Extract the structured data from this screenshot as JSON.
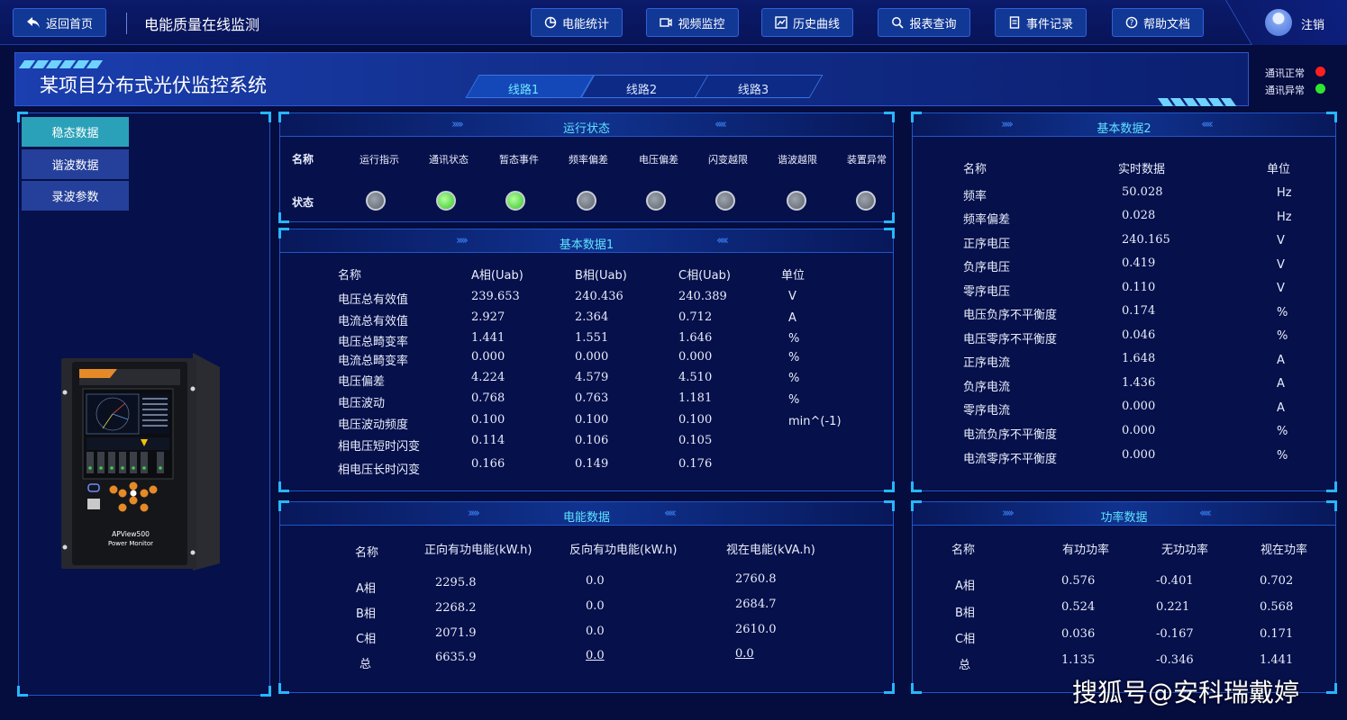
{
  "topbar": {
    "back_label": "返回首页",
    "title": "电能质量在线监测",
    "nav": [
      {
        "label": "电能统计",
        "icon": "pie-chart-icon"
      },
      {
        "label": "视频监控",
        "icon": "video-camera-icon"
      },
      {
        "label": "历史曲线",
        "icon": "line-chart-icon"
      },
      {
        "label": "报表查询",
        "icon": "search-icon"
      },
      {
        "label": "事件记录",
        "icon": "document-icon"
      },
      {
        "label": "帮助文档",
        "icon": "help-icon"
      }
    ],
    "logout_label": "注销"
  },
  "header": {
    "project_title": "某项目分布式光伏监控系统",
    "line_tabs": [
      "线路1",
      "线路2",
      "线路3"
    ],
    "active_tab": "线路1",
    "legend": [
      {
        "label": "通讯正常",
        "color": "#ff1f1f"
      },
      {
        "label": "通讯异常",
        "color": "#2ee62e"
      }
    ]
  },
  "sidebar": {
    "items": [
      "稳态数据",
      "谐波数据",
      "录波参数"
    ],
    "active": "稳态数据",
    "device": {
      "model": "APView500",
      "subtitle": "Power Monitor"
    }
  },
  "run_status": {
    "title": "运行状态",
    "row_name_label": "名称",
    "row_status_label": "状态",
    "items": [
      {
        "label": "运行指示",
        "state": "gray"
      },
      {
        "label": "通讯状态",
        "state": "green"
      },
      {
        "label": "暂态事件",
        "state": "green"
      },
      {
        "label": "频率偏差",
        "state": "gray"
      },
      {
        "label": "电压偏差",
        "state": "gray"
      },
      {
        "label": "闪变越限",
        "state": "gray"
      },
      {
        "label": "谐波越限",
        "state": "gray"
      },
      {
        "label": "装置异常",
        "state": "gray"
      }
    ]
  },
  "basic1": {
    "title": "基本数据1",
    "headers": [
      "名称",
      "A相(Uab)",
      "B相(Uab)",
      "C相(Uab)",
      "单位"
    ],
    "rows": [
      [
        "电压总有效值",
        "239.653",
        "240.436",
        "240.389",
        "V"
      ],
      [
        "电流总有效值",
        "2.927",
        "2.364",
        "0.712",
        "A"
      ],
      [
        "电压总畸变率",
        "1.441",
        "1.551",
        "1.646",
        "%"
      ],
      [
        "电流总畸变率",
        "0.000",
        "0.000",
        "0.000",
        "%"
      ],
      [
        "电压偏差",
        "4.224",
        "4.579",
        "4.510",
        "%"
      ],
      [
        "电压波动",
        "0.768",
        "0.763",
        "1.181",
        "%"
      ],
      [
        "电压波动频度",
        "0.100",
        "0.100",
        "0.100",
        "min^(-1)"
      ],
      [
        "相电压短时闪变",
        "0.114",
        "0.106",
        "0.105",
        ""
      ],
      [
        "相电压长时闪变",
        "0.166",
        "0.149",
        "0.176",
        ""
      ]
    ]
  },
  "basic2": {
    "title": "基本数据2",
    "headers": [
      "名称",
      "实时数据",
      "单位"
    ],
    "rows": [
      [
        "频率",
        "50.028",
        "Hz"
      ],
      [
        "频率偏差",
        "0.028",
        "Hz"
      ],
      [
        "正序电压",
        "240.165",
        "V"
      ],
      [
        "负序电压",
        "0.419",
        "V"
      ],
      [
        "零序电压",
        "0.110",
        "V"
      ],
      [
        "电压负序不平衡度",
        "0.174",
        "%"
      ],
      [
        "电压零序不平衡度",
        "0.046",
        "%"
      ],
      [
        "正序电流",
        "1.648",
        "A"
      ],
      [
        "负序电流",
        "1.436",
        "A"
      ],
      [
        "零序电流",
        "0.000",
        "A"
      ],
      [
        "电流负序不平衡度",
        "0.000",
        "%"
      ],
      [
        "电流零序不平衡度",
        "0.000",
        "%"
      ]
    ]
  },
  "energy": {
    "title": "电能数据",
    "headers": [
      "名称",
      "正向有功电能(kW.h)",
      "反向有功电能(kW.h)",
      "视在电能(kVA.h)"
    ],
    "rows": [
      [
        "A相",
        "2295.8",
        "0.0",
        "2760.8"
      ],
      [
        "B相",
        "2268.2",
        "0.0",
        "2684.7"
      ],
      [
        "C相",
        "2071.9",
        "0.0",
        "2610.0"
      ],
      [
        "总",
        "6635.9",
        "0.0",
        "0.0"
      ]
    ]
  },
  "power": {
    "title": "功率数据",
    "headers": [
      "名称",
      "有功功率",
      "无功功率",
      "视在功率"
    ],
    "rows": [
      [
        "A相",
        "0.576",
        "-0.401",
        "0.702"
      ],
      [
        "B相",
        "0.524",
        "0.221",
        "0.568"
      ],
      [
        "C相",
        "0.036",
        "-0.167",
        "0.171"
      ],
      [
        "总",
        "1.135",
        "-0.346",
        "1.441"
      ]
    ]
  },
  "watermark": "搜狐号@安科瑞戴婷"
}
